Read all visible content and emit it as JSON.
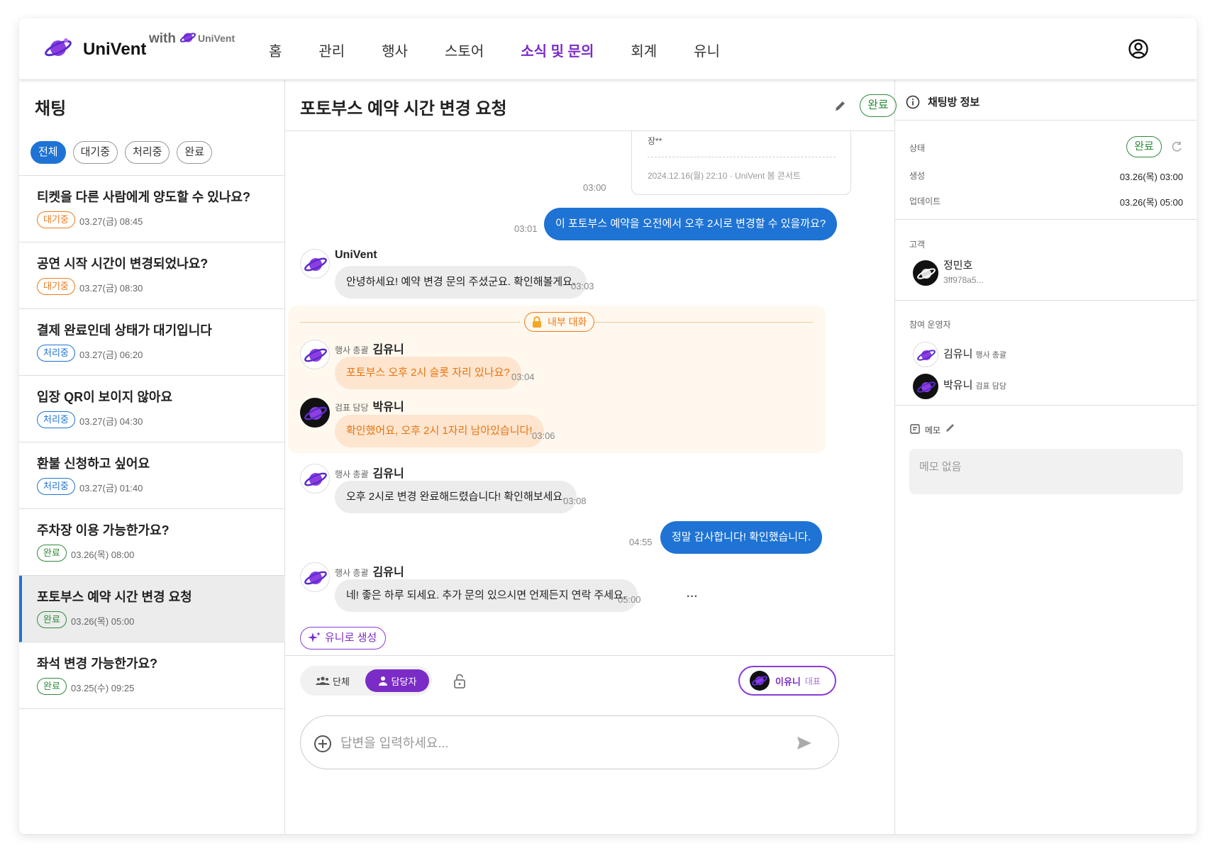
{
  "header": {
    "brand": "UniVent",
    "with_label": "with",
    "mini_brand": "UniVent",
    "nav": [
      {
        "label": "홈",
        "active": false
      },
      {
        "label": "관리",
        "active": false
      },
      {
        "label": "행사",
        "active": false
      },
      {
        "label": "스토어",
        "active": false
      },
      {
        "label": "소식 및 문의",
        "active": true
      },
      {
        "label": "회계",
        "active": false
      },
      {
        "label": "유니",
        "active": false
      }
    ],
    "user_icon": "user-circle-icon"
  },
  "left": {
    "title": "채팅",
    "filters": [
      "전체",
      "대기중",
      "처리중",
      "완료"
    ],
    "active_filter": "전체",
    "conversations": [
      {
        "title": "티켓을 다른 사람에게 양도할 수 있나요?",
        "status": "대기중",
        "time": "03.27(금) 08:45"
      },
      {
        "title": "공연 시작 시간이 변경되었나요?",
        "status": "대기중",
        "time": "03.27(금) 08:30"
      },
      {
        "title": "결제 완료인데 상태가 대기입니다",
        "status": "처리중",
        "time": "03.27(금) 06:20"
      },
      {
        "title": "입장 QR이 보이지 않아요",
        "status": "처리중",
        "time": "03.27(금) 04:30"
      },
      {
        "title": "환불 신청하고 싶어요",
        "status": "처리중",
        "time": "03.27(금) 01:40"
      },
      {
        "title": "주차장 이용 가능한가요?",
        "status": "완료",
        "time": "03.26(목) 08:00"
      },
      {
        "title": "포토부스 예약 시간 변경 요청",
        "status": "완료",
        "time": "03.26(목) 05:00"
      },
      {
        "title": "좌석 변경 가능한가요?",
        "status": "완료",
        "time": "03.25(수) 09:25"
      }
    ],
    "selected_index": 6
  },
  "center": {
    "title": "포토부스 예약 시간 변경 요청",
    "status": "완료",
    "card": {
      "name": "장**",
      "meta": "2024.12.16(월) 22:10 · UniVent 봄 콘서트",
      "time": "03:00"
    },
    "messages": [
      {
        "dir": "out",
        "text": "이 포토부스 예약을 오전에서 오후 2시로 변경할 수 있을까요?",
        "time": "03:01"
      },
      {
        "dir": "in",
        "sender": "UniVent",
        "role": "",
        "text": "안녕하세요! 예약 변경 문의 주셨군요. 확인해볼게요.",
        "time": "03:03"
      },
      {
        "dir": "out",
        "text": "정말 감사합니다! 확인했습니다.",
        "time": "04:55"
      },
      {
        "dir": "in",
        "sender": "김유니",
        "role": "행사 총괄",
        "text": "오후 2시로 변경 완료해드렸습니다! 확인해보세요.",
        "time": "03:08"
      },
      {
        "dir": "in",
        "sender": "김유니",
        "role": "행사 총괄",
        "text": "네! 좋은 하루 되세요. 추가 문의 있으시면 언제든지 연락 주세요.",
        "time": "05:00"
      }
    ],
    "internal": {
      "label": "내부 대화",
      "messages": [
        {
          "sender": "김유니",
          "role": "행사 총괄",
          "text": "포토부스 오후 2시 슬롯 자리 있나요?",
          "time": "03:04"
        },
        {
          "sender": "박유니",
          "role": "검표 담당",
          "text": "확인했어요, 오후 2시 1자리 남아있습니다!",
          "time": "03:06"
        }
      ]
    },
    "more": "···",
    "generate_button": "유니로 생성",
    "composer": {
      "tab_group": "단체",
      "tab_assignee": "담당자",
      "agent_name": "이유니",
      "agent_role": "대표",
      "placeholder": "답변을 입력하세요..."
    }
  },
  "right": {
    "title": "채팅방 정보",
    "status_label": "상태",
    "status": "완료",
    "created_label": "생성",
    "created": "03.26(목) 03:00",
    "updated_label": "업데이트",
    "updated": "03.26(목) 05:00",
    "customer_label": "고객",
    "customer_name": "정민호",
    "customer_id": "3ff978a5...",
    "operators_label": "참여 운영자",
    "operators": [
      {
        "name": "김유니",
        "role": "행사 총괄"
      },
      {
        "name": "박유니",
        "role": "검표 담당"
      }
    ],
    "memo_label": "메모",
    "memo_text": "메모 없음"
  },
  "colors": {
    "accent_purple": "#7b2cc7",
    "primary_blue": "#1e73d4",
    "waiting_orange": "#f07a1a",
    "done_green": "#2e8b3a",
    "internal_bg": "#fff8ee"
  }
}
